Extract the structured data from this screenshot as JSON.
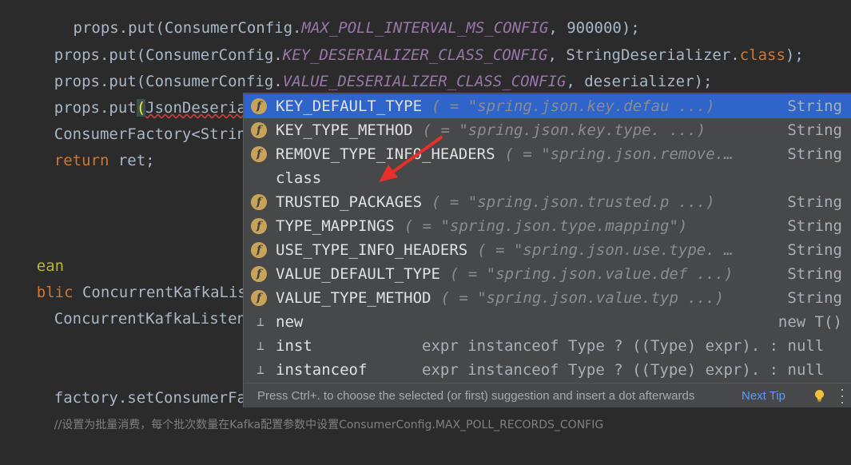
{
  "editor": {
    "lines": {
      "l0": {
        "a": "    props.put(ConsumerConfig.",
        "b": "MAX_POLL_INTERVAL_MS_CONFIG",
        "c": ", 900000);"
      },
      "l1": {
        "a": "props.put(ConsumerConfig.",
        "b": "KEY_DESERIALIZER_CLASS_CONFIG",
        "c": ", StringDeserializer.",
        "d": "class",
        "e": ");"
      },
      "l2": {
        "a": "props.put(ConsumerConfig.",
        "b": "VALUE_DESERIALIZER_CLASS_CONFIG",
        "c": ", deserializer);"
      },
      "l3": {
        "a": "props.put",
        "b": "(",
        "c": "JsonDeserializer.",
        "d": ")"
      },
      "l4": {
        "a": "ConsumerFactory<String,M"
      },
      "l5": {
        "kw": "return",
        "rest": " ret;"
      },
      "l6": {
        "text": "ean"
      },
      "l7": {
        "kw": "blic",
        "rest": " ConcurrentKafkaListener"
      },
      "l8": {
        "text": "ConcurrentKafkaListenerC"
      },
      "l9": {
        "text": "factory.setConsumerFacto"
      },
      "l10": {
        "text": "//设置为批量消费，每个批次数量在Kafka配置参数中设置ConsumerConfig.MAX_POLL_RECORDS_CONFIG"
      }
    }
  },
  "completion": {
    "items": [
      {
        "name": "KEY_DEFAULT_TYPE",
        "tail": "( = \"spring.json.key.defau ...)",
        "type": "String",
        "icon": "field-icon",
        "selected": true
      },
      {
        "name": "KEY_TYPE_METHOD",
        "tail": "( = \"spring.json.key.type. ...)",
        "type": "String",
        "icon": "field-icon"
      },
      {
        "name": "REMOVE_TYPE_INFO_HEADERS",
        "tail": "( = \"spring.json.remove.…",
        "type": "String",
        "icon": "field-icon"
      },
      {
        "name": "class",
        "tail": "",
        "type": "",
        "icon": "none"
      },
      {
        "name": "TRUSTED_PACKAGES",
        "tail": "( = \"spring.json.trusted.p ...)",
        "type": "String",
        "icon": "field-icon"
      },
      {
        "name": "TYPE_MAPPINGS",
        "tail": "( = \"spring.json.type.mapping\")",
        "type": "String",
        "icon": "field-icon"
      },
      {
        "name": "USE_TYPE_INFO_HEADERS",
        "tail": "( = \"spring.json.use.type. …",
        "type": "String",
        "icon": "field-icon"
      },
      {
        "name": "VALUE_DEFAULT_TYPE",
        "tail": "( = \"spring.json.value.def ...)",
        "type": "String",
        "icon": "field-icon"
      },
      {
        "name": "VALUE_TYPE_METHOD",
        "tail": "( = \"spring.json.value.typ ...)",
        "type": "String",
        "icon": "field-icon"
      }
    ],
    "templates": [
      {
        "name": "new",
        "desc": "",
        "type": "new T()",
        "icon": "template-icon"
      },
      {
        "name": "inst",
        "desc": "expr instanceof Type ? ((Type) expr). : null",
        "type": "",
        "icon": "template-icon"
      },
      {
        "name": "instanceof",
        "desc": "expr instanceof Type ? ((Type) expr). : null",
        "type": "",
        "icon": "template-icon"
      }
    ],
    "footer": {
      "hint": "Press Ctrl+. to choose the selected (or first) suggestion and insert a dot afterwards",
      "next_tip": "Next Tip"
    },
    "field_icon_letter": "f"
  },
  "colors": {
    "editor_bg": "#2b2b2b",
    "popup_bg": "#46484a",
    "selected_row": "#2f65ca",
    "annotation_arrow": "#e8302a"
  }
}
